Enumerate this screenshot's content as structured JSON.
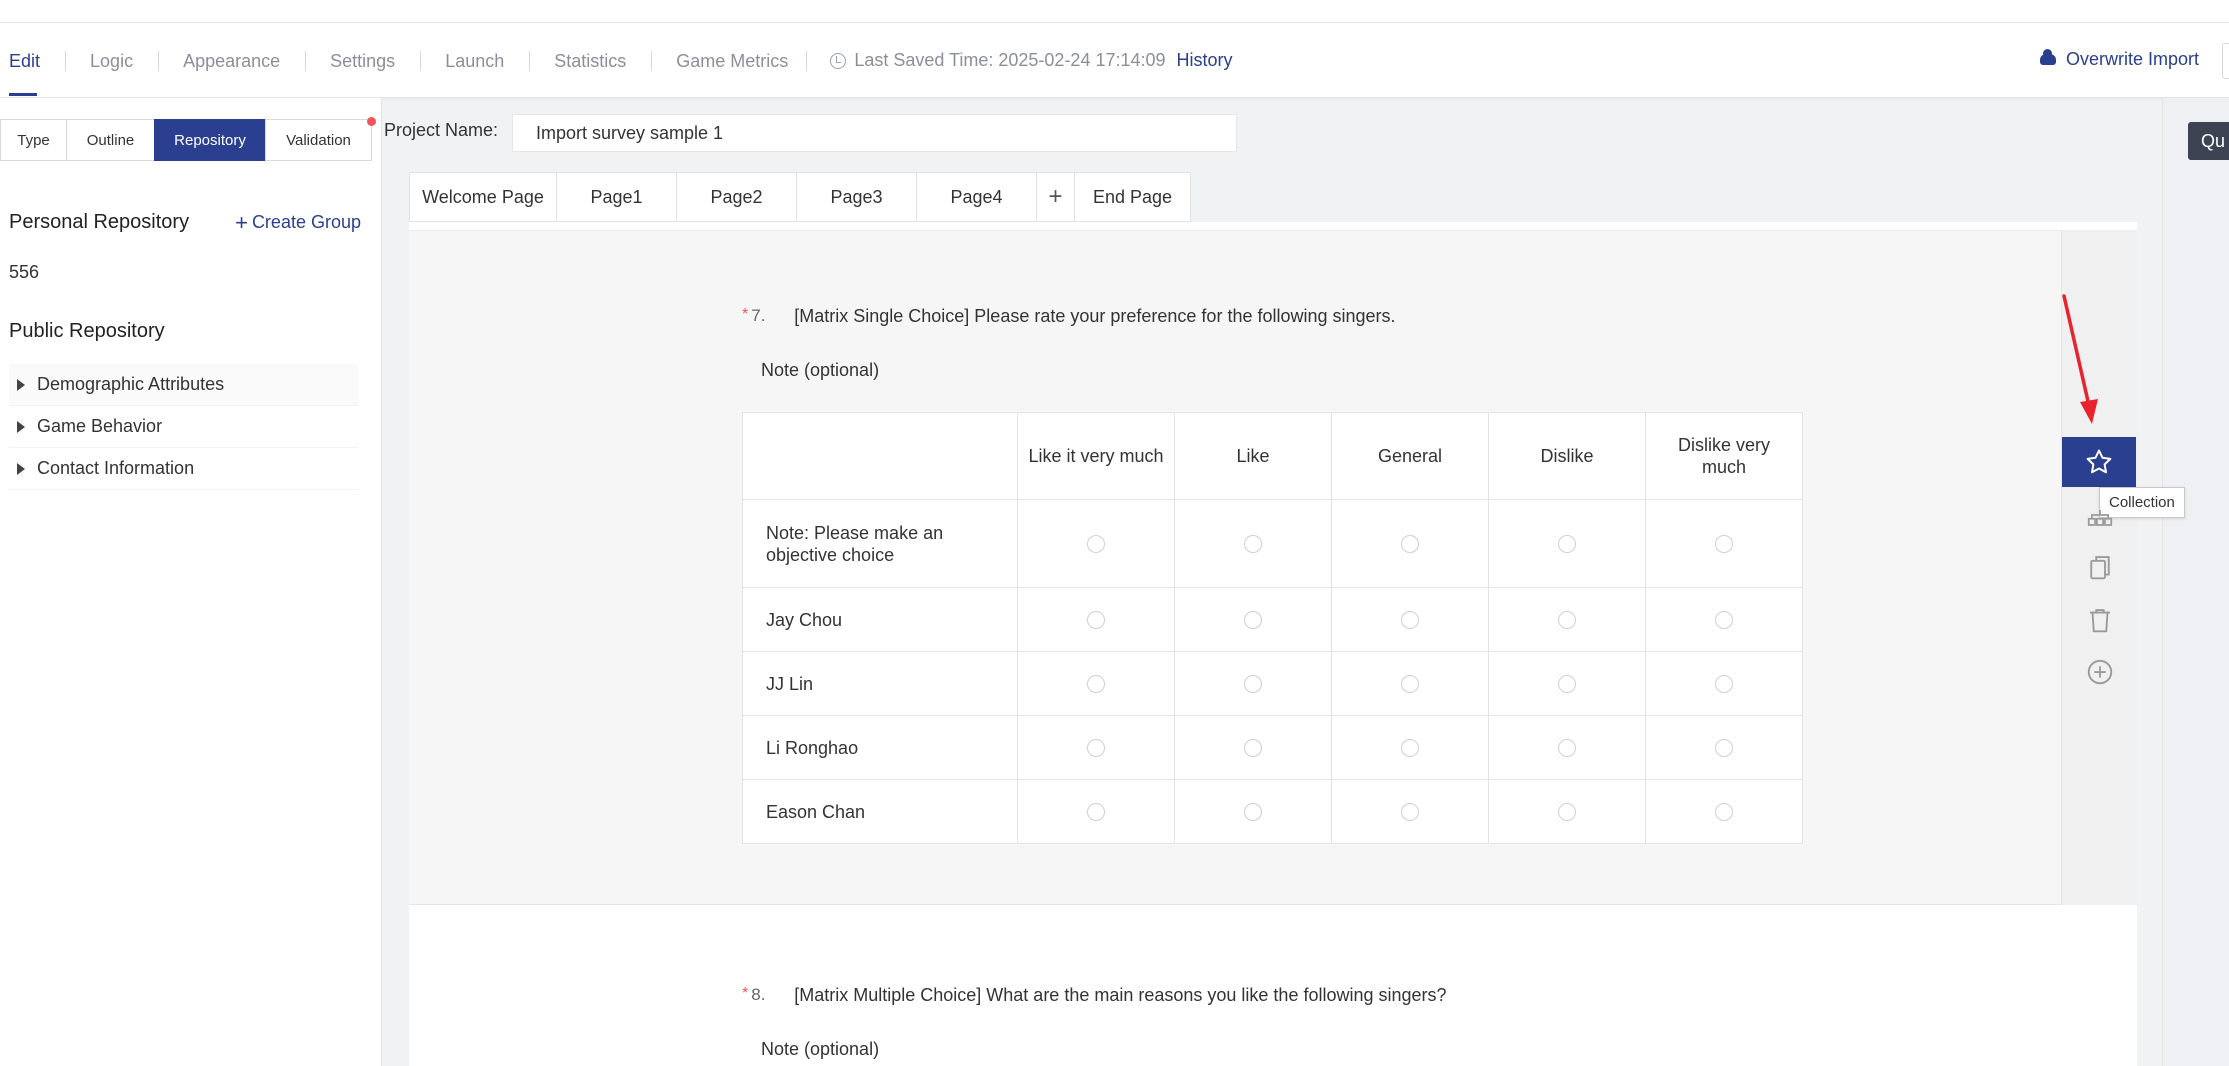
{
  "nav": {
    "tabs": [
      "Edit",
      "Logic",
      "Appearance",
      "Settings",
      "Launch",
      "Statistics",
      "Game Metrics"
    ],
    "saved_text": "Last Saved Time: 2025-02-24 17:14:09",
    "history": "History",
    "overwrite_import": "Overwrite Import"
  },
  "sidebar": {
    "tabs": [
      "Type",
      "Outline",
      "Repository",
      "Validation"
    ],
    "personal_repository": "Personal Repository",
    "create_group": "Create Group",
    "personal_count": "556",
    "public_repository": "Public Repository",
    "public_items": [
      "Demographic Attributes",
      "Game Behavior",
      "Contact Information"
    ]
  },
  "project": {
    "label": "Project Name:",
    "name": "Import survey sample 1"
  },
  "pages": [
    "Welcome Page",
    "Page1",
    "Page2",
    "Page3",
    "Page4",
    "+",
    "End Page"
  ],
  "questions": {
    "q7": {
      "required": "*",
      "number": "7.",
      "title": "[Matrix Single Choice] Please rate your preference for the following singers.",
      "note": "Note (optional)",
      "columns": [
        "Like it very much",
        "Like",
        "General",
        "Dislike",
        "Dislike very much"
      ],
      "rows": [
        "Note: Please make an objective choice",
        "Jay Chou",
        "JJ Lin",
        "Li Ronghao",
        "Eason Chan"
      ]
    },
    "q8": {
      "required": "*",
      "number": "8.",
      "title": "[Matrix Multiple Choice] What are the main reasons you like the following singers?",
      "note": "Note (optional)"
    }
  },
  "tools": {
    "tooltip": "Collection",
    "quick_button": "Qu"
  },
  "colors": {
    "primary": "#2a3f8f",
    "required": "#f5545c",
    "annotation_arrow": "#e8232e"
  }
}
